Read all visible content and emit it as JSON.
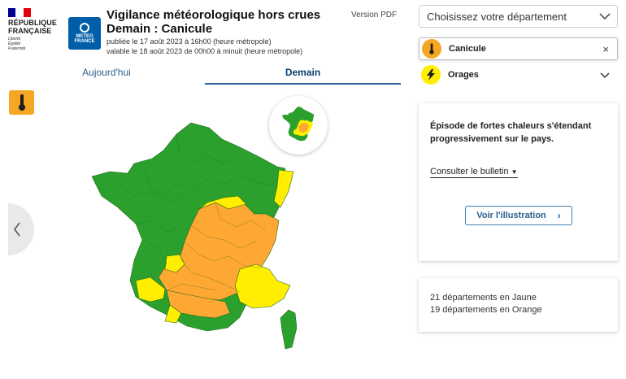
{
  "colors": {
    "green": "#2ca02c",
    "yellow": "#ffee00",
    "orange": "#ffa733",
    "flag_blue": "#000091",
    "flag_red": "#e1000f",
    "meteo_blue": "#005ea8",
    "badge_orange": "#f5a623"
  },
  "header": {
    "rf_title_line1": "RÉPUBLIQUE",
    "rf_title_line2": "FRANÇAISE",
    "rf_motto_line1": "Liberté",
    "rf_motto_line2": "Égalité",
    "rf_motto_line3": "Fraternité",
    "meteo_line1": "METEO",
    "meteo_line2": "FRANCE",
    "title": "Vigilance météorologique hors crues Demain : Canicule",
    "published": "publiée le 17 août 2023 à 16h00 (heure métropole)",
    "valid": "valable le 18 août 2023 de 00h00 à minuit (heure métropole)",
    "pdf": "Version PDF"
  },
  "tabs": {
    "today": "Aujourd'hui",
    "tomorrow": "Demain"
  },
  "left": {
    "badge_icon": "thermometer-icon",
    "prev_icon": "chevron-left-icon"
  },
  "panel": {
    "select_placeholder": "Choisissez votre département",
    "hazards": [
      {
        "label": "Canicule",
        "icon": "thermometer-icon",
        "action": "×",
        "level_color": "#f5a623"
      },
      {
        "label": "Orages",
        "icon": "lightning-icon",
        "action": "⌄",
        "level_color": "#ffee00"
      }
    ],
    "episode_text": "Épisode de fortes chaleurs s'étendant progressivement sur le pays.",
    "bulletin_link": "Consulter le bulletin",
    "illustration_button": "Voir l'illustration",
    "count_yellow": "21 départements en Jaune",
    "count_orange": "19 départements en Orange"
  },
  "map": {
    "legend_levels": [
      "green",
      "yellow",
      "orange"
    ],
    "zones": [
      "green",
      "yellow",
      "orange",
      "yellow",
      "orange",
      "orange",
      "yellow",
      "yellow",
      "orange",
      "yellow"
    ]
  }
}
